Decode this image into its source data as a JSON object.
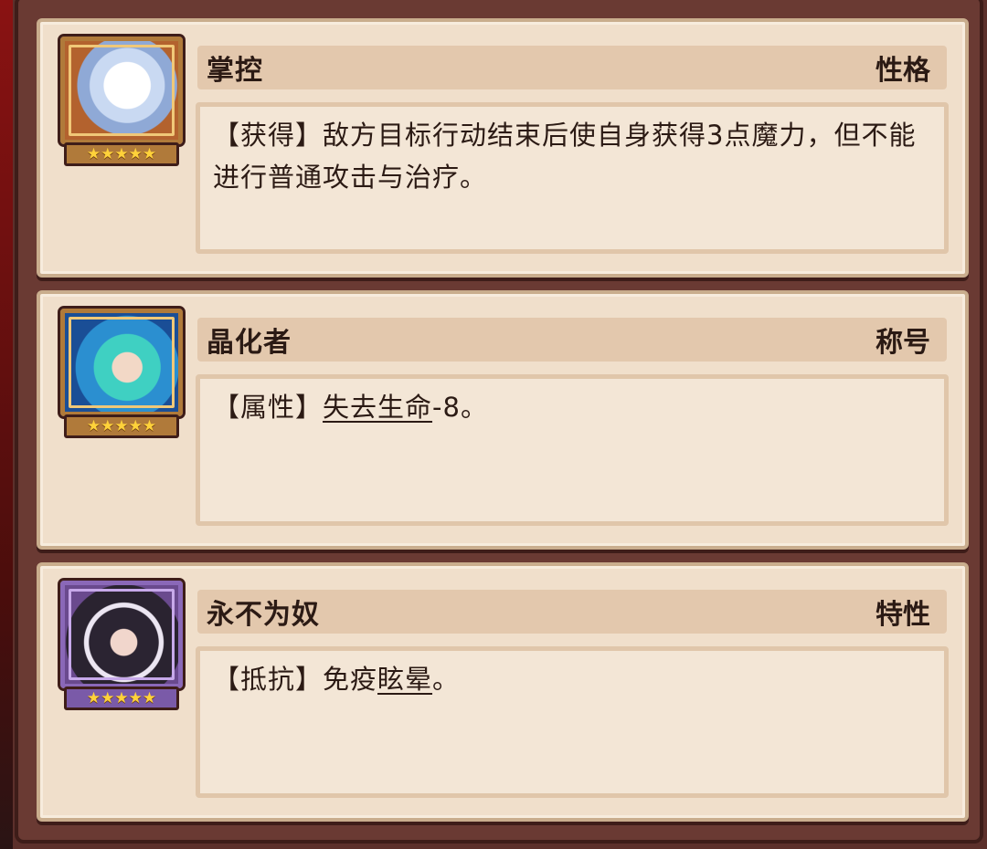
{
  "cards": [
    {
      "portrait_icon": "white-haired-character-portrait",
      "stars": "★★★★★",
      "name": "掌控",
      "tag": "性格",
      "desc": "【获得】敌方目标行动结束后使自身获得3点魔力，但不能进行普通攻击与治疗。"
    },
    {
      "portrait_icon": "teal-haired-character-portrait",
      "stars": "★★★★★",
      "name": "晶化者",
      "tag": "称号",
      "desc_prefix": "【属性】",
      "desc_link": "失去生命",
      "desc_suffix": "-8。"
    },
    {
      "portrait_icon": "black-white-haired-character-portrait",
      "stars": "★★★★★",
      "name": "永不为奴",
      "tag": "特性",
      "desc_prefix": "【抵抗】免疫",
      "desc_link": "眩晕",
      "desc_suffix": "。"
    }
  ]
}
